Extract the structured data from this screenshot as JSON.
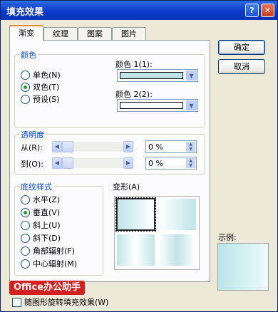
{
  "window": {
    "title": "填充效果",
    "help_glyph": "?",
    "close_glyph": "✕"
  },
  "tabs": [
    {
      "label": "渐变",
      "active": true
    },
    {
      "label": "纹理",
      "active": false
    },
    {
      "label": "图案",
      "active": false
    },
    {
      "label": "图片",
      "active": false
    }
  ],
  "colors_group": {
    "legend": "颜色",
    "options": [
      {
        "label": "单色(N)",
        "selected": false
      },
      {
        "label": "双色(T)",
        "selected": true
      },
      {
        "label": "预设(S)",
        "selected": false
      }
    ],
    "color1_label": "颜色 1(1):",
    "color1_value": "#bfe4e8",
    "color2_label": "颜色 2(2):",
    "color2_value": "#ffffff"
  },
  "transparency_group": {
    "legend": "透明度",
    "from_label": "从(R):",
    "from_value": "0 %",
    "to_label": "到(O):",
    "to_value": "0 %"
  },
  "shading_group": {
    "legend": "底纹样式",
    "options": [
      {
        "label": "水平(Z)",
        "selected": false
      },
      {
        "label": "垂直(V)",
        "selected": true
      },
      {
        "label": "斜上(U)",
        "selected": false
      },
      {
        "label": "斜下(D)",
        "selected": false
      },
      {
        "label": "角部辐射(F)",
        "selected": false
      },
      {
        "label": "中心辐射(M)",
        "selected": false
      }
    ]
  },
  "variants_group": {
    "legend": "变形(A)"
  },
  "buttons": {
    "ok": "确定",
    "cancel": "取消"
  },
  "sample_label": "示例:",
  "watermark": "Office办公助手",
  "rotate_checkbox_label": "随图形旋转填充效果(W)"
}
